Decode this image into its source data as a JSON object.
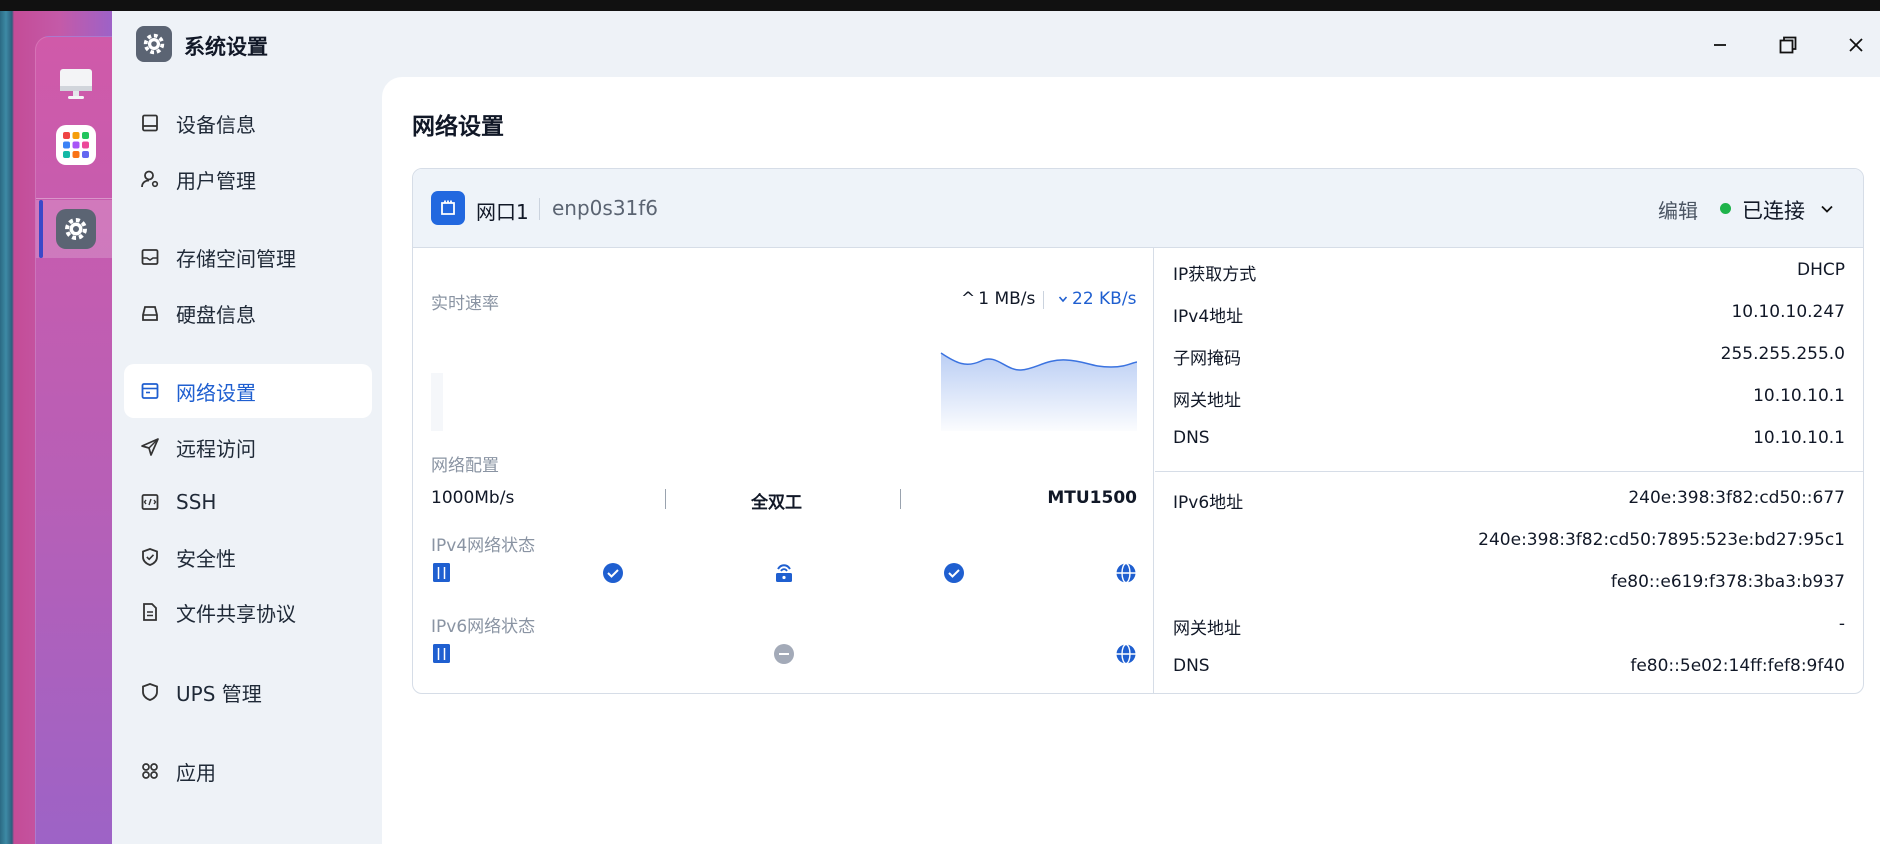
{
  "window": {
    "title": "系统设置",
    "controls": {
      "minimize": "minimize-icon",
      "maximize": "restore-icon",
      "close": "close-icon"
    }
  },
  "sidebar": {
    "items": [
      {
        "label": "设备信息",
        "icon": "device-icon",
        "active": false
      },
      {
        "label": "用户管理",
        "icon": "user-settings-icon",
        "active": false
      },
      {
        "label": "存储空间管理",
        "icon": "storage-icon",
        "active": false
      },
      {
        "label": "硬盘信息",
        "icon": "disk-icon",
        "active": false
      },
      {
        "label": "网络设置",
        "icon": "network-icon",
        "active": true
      },
      {
        "label": "远程访问",
        "icon": "send-icon",
        "active": false
      },
      {
        "label": "SSH",
        "icon": "terminal-icon",
        "active": false
      },
      {
        "label": "安全性",
        "icon": "shield-check-icon",
        "active": false
      },
      {
        "label": "文件共享协议",
        "icon": "document-icon",
        "active": false
      },
      {
        "label": "UPS 管理",
        "icon": "shield-icon",
        "active": false
      },
      {
        "label": "应用",
        "icon": "apps-icon",
        "active": false
      }
    ]
  },
  "main": {
    "title": "网络设置",
    "port": {
      "name": "网口1",
      "interface": "enp0s31f6",
      "edit_label": "编辑",
      "status": "已连接",
      "status_color": "#1eb34b"
    },
    "realtime": {
      "label": "实时速率",
      "upload": "1 MB/s",
      "download": "22 KB/s"
    },
    "config": {
      "label": "网络配置",
      "speed": "1000Mb/s",
      "duplex": "全双工",
      "mtu": "MTU1500"
    },
    "ipv4_status": {
      "label": "IPv4网络状态",
      "gateway_ok": true,
      "internet_ok": true
    },
    "ipv6_status": {
      "label": "IPv6网络状态",
      "gateway_ok": false
    },
    "ipv4_info": [
      {
        "key": "IP获取方式",
        "value": "DHCP"
      },
      {
        "key": "IPv4地址",
        "value": "10.10.10.247"
      },
      {
        "key": "子网掩码",
        "value": "255.255.255.0"
      },
      {
        "key": "网关地址",
        "value": "10.10.10.1"
      },
      {
        "key": "DNS",
        "value": "10.10.10.1"
      }
    ],
    "ipv6_info": [
      {
        "key": "IPv6地址",
        "value": "240e:398:3f82:cd50::677"
      },
      {
        "key": "",
        "value": "240e:398:3f82:cd50:7895:523e:bd27:95c1"
      },
      {
        "key": "",
        "value": "fe80::e619:f378:3ba3:b937"
      },
      {
        "key": "网关地址",
        "value": "-"
      },
      {
        "key": "DNS",
        "value": "fe80::5e02:14ff:fef8:9f40"
      }
    ]
  },
  "colors": {
    "accent": "#1f5fd0",
    "connected": "#1eb34b"
  }
}
